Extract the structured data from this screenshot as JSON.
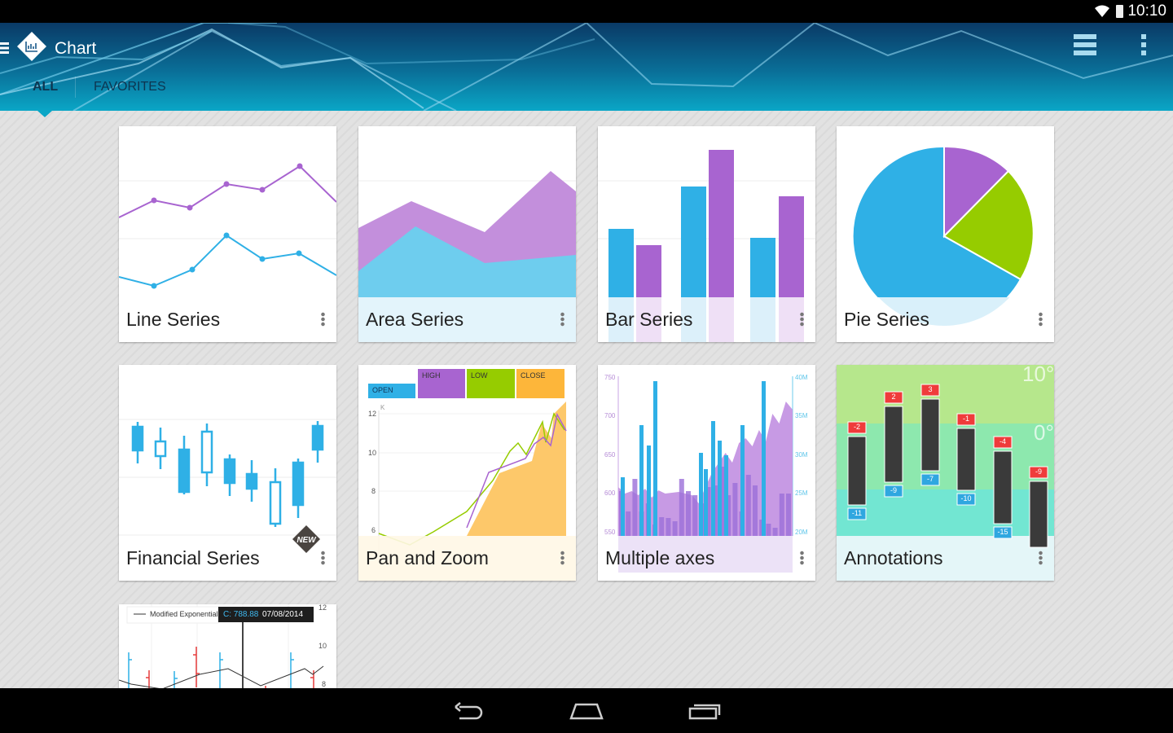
{
  "status_bar": {
    "time": "10:10",
    "icons": [
      "wifi-icon",
      "battery-icon"
    ]
  },
  "app_bar": {
    "title": "Chart",
    "tabs": [
      {
        "label": "ALL",
        "active": true
      },
      {
        "label": "FAVORITES",
        "active": false
      }
    ],
    "icons": [
      "menu-icon",
      "app-logo-icon",
      "list-view-icon",
      "overflow-menu-icon"
    ]
  },
  "colors": {
    "blue": "#2fb0e6",
    "purple": "#a864d0",
    "green": "#96cc00",
    "orange": "#fdb63a",
    "red": "#ef3b3b",
    "dark": "#3a3a3a",
    "appbar_top": "#0a3a66",
    "appbar_bottom": "#0aa6c6"
  },
  "cards": [
    {
      "title": "Line Series"
    },
    {
      "title": "Area Series"
    },
    {
      "title": "Bar Series"
    },
    {
      "title": "Pie Series"
    },
    {
      "title": "Financial Series",
      "badge": "NEW"
    },
    {
      "title": "Pan and Zoom",
      "legend": [
        "OPEN",
        "HIGH",
        "LOW",
        "CLOSE"
      ],
      "y_ticks": [
        "12",
        "10",
        "8",
        "6"
      ],
      "y_unit": "K"
    },
    {
      "title": "Multiple axes",
      "left_ticks": [
        "750",
        "700",
        "650",
        "600",
        "550"
      ],
      "right_ticks": [
        "40M",
        "35M",
        "30M",
        "25M",
        "20M"
      ]
    },
    {
      "title": "Annotations",
      "high_values": [
        "-2",
        "2",
        "3",
        "-1",
        "-4",
        "-9"
      ],
      "low_values": [
        "-11",
        "-9",
        "-7",
        "-10",
        "-15"
      ],
      "bands": [
        "10°",
        "0°"
      ]
    },
    {
      "legend": "Modified Exponential",
      "tooltip_value": "C: 788.88",
      "tooltip_date": "07/08/2014",
      "y_ticks": [
        "12",
        "10",
        "8"
      ]
    }
  ],
  "nav_bar": {
    "icons": [
      "back-icon",
      "home-icon",
      "recent-apps-icon"
    ]
  }
}
